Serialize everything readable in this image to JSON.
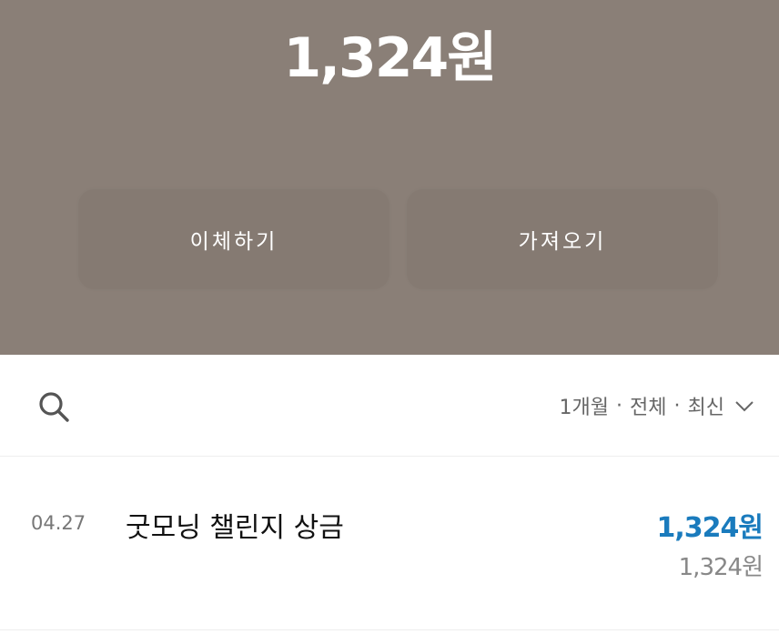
{
  "header": {
    "balance": "1,324원",
    "transfer_label": "이체하기",
    "fetch_label": "가져오기"
  },
  "toolbar": {
    "search_icon": "search-icon",
    "filter": {
      "period": "1개월",
      "type": "전체",
      "sort": "최신",
      "separator": "·"
    }
  },
  "transactions": [
    {
      "date": "04.27",
      "title": "굿모닝 챌린지 상금",
      "amount": "1,324원",
      "balance": "1,324원"
    }
  ],
  "colors": {
    "header_bg": "#8a7f77",
    "amount_blue": "#1a7bbd"
  }
}
